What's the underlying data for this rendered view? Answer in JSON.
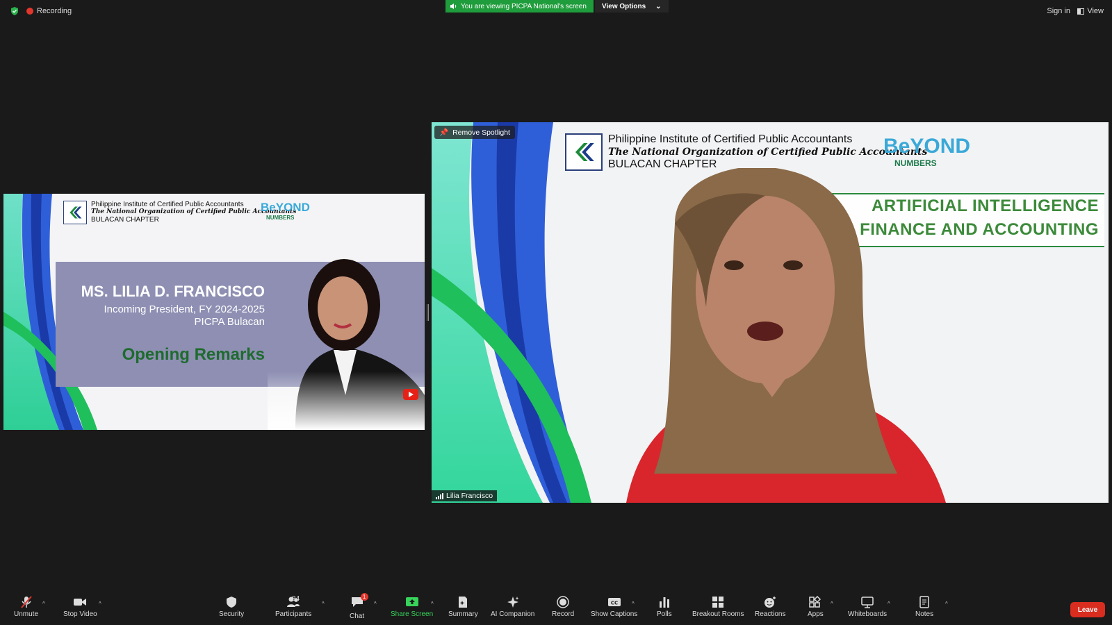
{
  "topbar": {
    "recording_label": "Recording",
    "viewing_banner": "You are viewing PICPA National's screen",
    "view_options_label": "View Options",
    "sign_in_label": "Sign in",
    "view_label": "View"
  },
  "left_tile": {
    "org_line1": "Philippine Institute of Certified Public Accountants",
    "org_line2": "The National Organization of Certified Public Accountants",
    "org_line3": "BULACAN CHAPTER",
    "logo_word1": "BeYOND",
    "logo_word2": "NUMBERS",
    "speaker_name": "MS. LILIA D. FRANCISCO",
    "speaker_role": "Incoming President, FY 2024-2025",
    "speaker_org": "PICPA Bulacan",
    "session_title": "Opening Remarks"
  },
  "right_tile": {
    "remove_spotlight_label": "Remove Spotlight",
    "participant_name": "Lilia Francisco",
    "org_line1": "Philippine Institute of Certified Public Accountants",
    "org_line2": "The National Organization of Certified Public Accountants",
    "org_line3": "BULACAN CHAPTER",
    "logo_word1": "BeYOND",
    "logo_word2": "NUMBERS",
    "topic_line1": "ARTIFICIAL INTELLIGENCE",
    "topic_line2": "OR FINANCE AND ACCOUNTING"
  },
  "toolbar": {
    "unmute": "Unmute",
    "stop_video": "Stop Video",
    "security": "Security",
    "participants": "Participants",
    "participants_count": "84",
    "chat": "Chat",
    "chat_badge": "1",
    "share_screen": "Share Screen",
    "summary": "Summary",
    "ai_companion": "AI Companion",
    "record": "Record",
    "show_captions": "Show Captions",
    "polls": "Polls",
    "breakout_rooms": "Breakout Rooms",
    "reactions": "Reactions",
    "apps": "Apps",
    "whiteboards": "Whiteboards",
    "notes": "Notes",
    "leave": "Leave"
  },
  "colors": {
    "background": "#1a1a1a",
    "share_green": "#1f9c3b",
    "leave_red": "#d92d20",
    "slide_green": "#1e6b2e",
    "band_purple": "#8e8fb3"
  }
}
